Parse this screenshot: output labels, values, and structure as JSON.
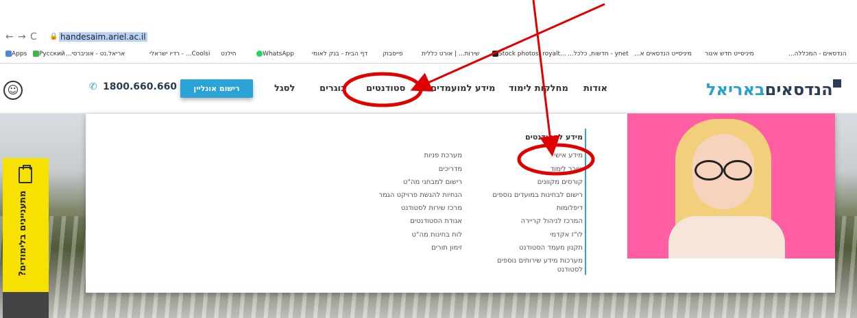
{
  "browser": {
    "url": "handesaim.ariel.ac.il",
    "bookmarks": [
      {
        "label": "Apps"
      },
      {
        "label": "Русский"
      },
      {
        "label": "אריאל.נט - אוניברסי..."
      },
      {
        "label": "Coolsi... - רדיו ישראלי"
      },
      {
        "label": "חילנט"
      },
      {
        "label": "WhatsApp"
      },
      {
        "label": "דף הבית - בנק לאומי"
      },
      {
        "label": "פייסבוק"
      },
      {
        "label": "שירות... | אורט כללית"
      },
      {
        "label": "Stock photos, royalt..."
      },
      {
        "label": "ynet - חדשות, כלכל..."
      },
      {
        "label": "מיניסייט הנדסאים א..."
      },
      {
        "label": "מיניסייט חדש איגור"
      },
      {
        "label": "הנדסאים - המכללה..."
      }
    ]
  },
  "site": {
    "logo_part1": "הנדסאים",
    "logo_part2": "באריאל",
    "nav": {
      "about": "אודות",
      "departments": "מחלקות לימוד",
      "candidates": "מידע למועמדים",
      "students": "סטודנטים",
      "graduates": "בוגרים",
      "staff": "לסגל"
    },
    "cta": "רישום אונליין",
    "phone": "1800.660.660"
  },
  "mega_menu": {
    "heading": "מידע לסטודנטים",
    "col1": [
      "מידע אישי",
      "שובר לימוד",
      "קורסים מקוונים",
      "רישום לבחינות במועדים נוספים",
      "דיפלומות",
      "המרכז לניהול קריירה",
      "לו\"ז אקדמי",
      "תקנון מעמד הסטודנט",
      "מערכות מידע שירותים נוספים",
      "לסטודנט"
    ],
    "col2": [
      "מערכת פניות",
      "מדריכים",
      "רישום למבחני מה\"ט",
      "הנחיות להגשת פרויקט הגמר",
      "מרכז שירות לסטודנט",
      "אגודת הסטודנטים",
      "לוח בחינות מה\"ט",
      "זימון תורים"
    ]
  },
  "side_tab": {
    "label": "מתעניינים בלימודים?"
  },
  "colors": {
    "brand_dark": "#2a3d57",
    "brand_light": "#2aa3d6",
    "annotation_red": "#e00000",
    "side_tab": "#f6e100"
  },
  "icons": [
    "back-arrow-icon",
    "forward-arrow-icon",
    "reload-icon",
    "lock-icon",
    "phone-icon",
    "accessibility-icon",
    "clipboard-icon"
  ]
}
